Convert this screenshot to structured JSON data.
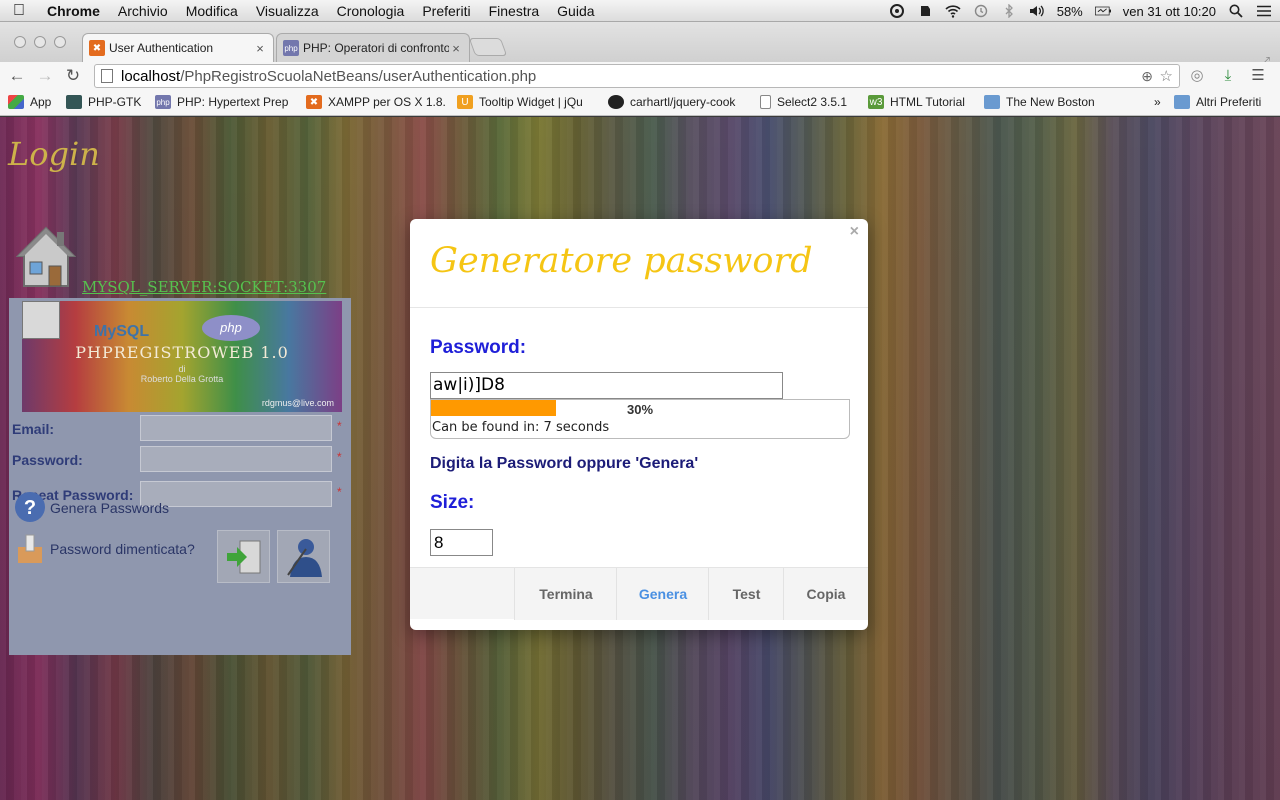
{
  "menubar": {
    "app": "Chrome",
    "items": [
      "Archivio",
      "Modifica",
      "Visualizza",
      "Cronologia",
      "Preferiti",
      "Finestra",
      "Guida"
    ],
    "battery": "58%",
    "datetime": "ven 31 ott  10:20"
  },
  "tabs": [
    {
      "title": "User Authentication",
      "icon": "xampp-icon"
    },
    {
      "title": "PHP: Operatori di confronto",
      "icon": "php-icon"
    }
  ],
  "address": {
    "host": "localhost",
    "path": "/PhpRegistroScuolaNetBeans/userAuthentication.php"
  },
  "bookmarks": [
    {
      "label": "App",
      "icon": "apps-grid-icon"
    },
    {
      "label": "PHP-GTK",
      "icon": "gtk-icon"
    },
    {
      "label": "PHP: Hypertext Prep",
      "icon": "php-icon"
    },
    {
      "label": "XAMPP per OS X 1.8.",
      "icon": "xampp-icon"
    },
    {
      "label": "Tooltip Widget | jQu",
      "icon": "jquery-icon"
    },
    {
      "label": "carhartl/jquery-cook",
      "icon": "github-icon"
    },
    {
      "label": "Select2 3.5.1",
      "icon": "page-icon"
    },
    {
      "label": "HTML Tutorial",
      "icon": "w3-icon"
    },
    {
      "label": "The New Boston",
      "icon": "folder-icon"
    }
  ],
  "bookmarks_more": "»",
  "bookmarks_other": "Altri Preferiti",
  "login": {
    "title": "Login",
    "server_link": "MYSQL_SERVER:SOCKET:3307",
    "banner_title": "PHPREGISTROWEB 1.0",
    "banner_sub": "di\nRoberto Della Grotta",
    "banner_email": "rdgmus@live.com",
    "banner_mysql": "MySQL",
    "banner_php": "php",
    "email_label": "Email:",
    "password_label": "Password:",
    "repeat_label": "Repeat Password:",
    "required_mark": "*",
    "generate_link": "Genera Passwords",
    "forgot_link": "Password dimenticata?"
  },
  "modal": {
    "close": "×",
    "title": "Generatore password",
    "password_label": "Password:",
    "password_value": "aw|i)]D8",
    "strength_percent": 30,
    "strength_text": "30%",
    "crack_time": "Can be found in: 7 seconds",
    "hint": "Digita la Password oppure 'Genera'",
    "size_label": "Size:",
    "size_value": "8",
    "buttons": [
      "Termina",
      "Genera",
      "Test",
      "Copia"
    ],
    "meter_color": "#ff9900",
    "title_color": "#f5c514",
    "label_color": "#1f1fd8"
  }
}
